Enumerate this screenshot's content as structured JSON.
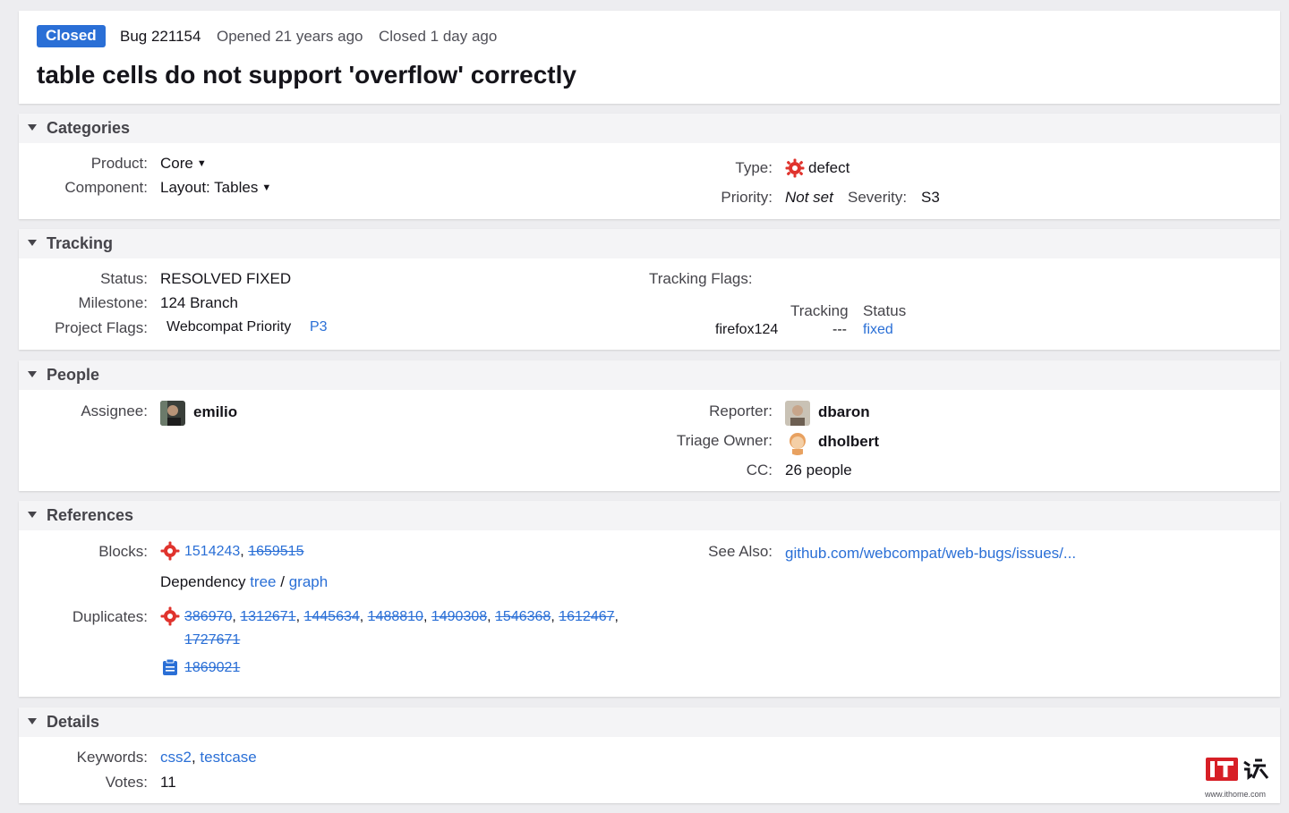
{
  "summary": {
    "status_badge": "Closed",
    "bug_id": "Bug 221154",
    "opened": "Opened 21 years ago",
    "closed": "Closed 1 day ago",
    "title": "table cells do not support 'overflow' correctly"
  },
  "categories": {
    "heading": "Categories",
    "product_label": "Product:",
    "product_value": "Core",
    "component_label": "Component:",
    "component_value": "Layout: Tables",
    "type_label": "Type:",
    "type_value": "defect",
    "priority_label": "Priority:",
    "priority_value": "Not set",
    "severity_label": "Severity:",
    "severity_value": "S3"
  },
  "tracking": {
    "heading": "Tracking",
    "status_label": "Status:",
    "status_value": "RESOLVED FIXED",
    "milestone_label": "Milestone:",
    "milestone_value": "124 Branch",
    "project_flags_label": "Project Flags:",
    "project_flag_name": "Webcompat Priority",
    "project_flag_value": "P3",
    "tracking_flags_label": "Tracking Flags:",
    "col_tracking": "Tracking",
    "col_status": "Status",
    "row_name": "firefox124",
    "row_tracking": "---",
    "row_status": "fixed"
  },
  "people": {
    "heading": "People",
    "assignee_label": "Assignee:",
    "assignee": "emilio",
    "reporter_label": "Reporter:",
    "reporter": "dbaron",
    "triage_label": "Triage Owner:",
    "triage_owner": "dholbert",
    "cc_label": "CC:",
    "cc_value": "26 people"
  },
  "references": {
    "heading": "References",
    "blocks_label": "Blocks:",
    "blocks": [
      "1514243",
      "1659515"
    ],
    "dependency_prefix": "Dependency",
    "dep_tree": "tree",
    "dep_sep": "/",
    "dep_graph": "graph",
    "duplicates_label": "Duplicates:",
    "duplicates": [
      "386970",
      "1312671",
      "1445634",
      "1488810",
      "1490308",
      "1546368",
      "1612467",
      "1727671"
    ],
    "duplicate_task": "1869021",
    "see_also_label": "See Also:",
    "see_also": "github.com/webcompat/web-bugs/issues/..."
  },
  "details": {
    "heading": "Details",
    "keywords_label": "Keywords:",
    "keywords": [
      "css2",
      "testcase"
    ],
    "votes_label": "Votes:",
    "votes_value": "11"
  },
  "watermark": {
    "url": "www.ithome.com",
    "logo_text": "IT之家"
  },
  "colors": {
    "link": "#2a6fd6",
    "badge": "#2a6fd6",
    "defect_icon": "#e0332d"
  }
}
